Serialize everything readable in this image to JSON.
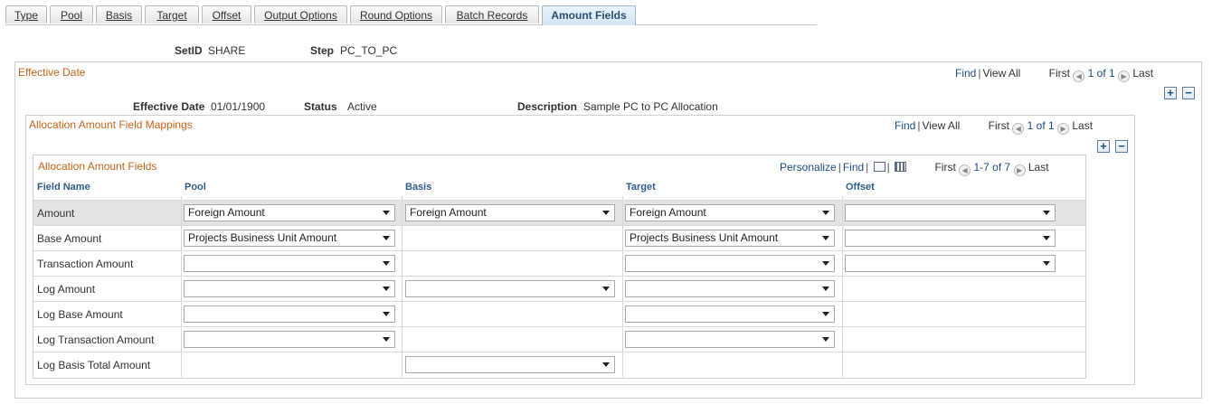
{
  "tabs": [
    {
      "label": "Type"
    },
    {
      "label": "Pool"
    },
    {
      "label": "Basis"
    },
    {
      "label": "Target"
    },
    {
      "label": "Offset"
    },
    {
      "label": "Output Options"
    },
    {
      "label": "Round Options"
    },
    {
      "label": "Batch Records"
    },
    {
      "label": "Amount Fields"
    }
  ],
  "header": {
    "setid_label": "SetID",
    "setid_value": "SHARE",
    "step_label": "Step",
    "step_value": "PC_TO_PC"
  },
  "effective_date_section": {
    "title": "Effective Date",
    "nav": {
      "find": "Find",
      "view_all": "View All",
      "first": "First",
      "count": "1 of 1",
      "last": "Last"
    },
    "effective_date_label": "Effective Date",
    "effective_date_value": "01/01/1900",
    "status_label": "Status",
    "status_value": "Active",
    "description_label": "Description",
    "description_value": "Sample PC to PC Allocation"
  },
  "mappings_section": {
    "title": "Allocation Amount Field Mappings",
    "nav": {
      "find": "Find",
      "view_all": "View All",
      "first": "First",
      "count": "1 of 1",
      "last": "Last"
    }
  },
  "grid": {
    "title": "Allocation Amount Fields",
    "nav": {
      "personalize": "Personalize",
      "find": "Find",
      "first": "First",
      "count": "1-7 of 7",
      "last": "Last"
    },
    "columns": [
      "Field Name",
      "Pool",
      "Basis",
      "Target",
      "Offset"
    ],
    "rows": [
      {
        "field": "Amount",
        "pool": "Foreign Amount",
        "basis": "Foreign Amount",
        "target": "Foreign Amount",
        "offset": ""
      },
      {
        "field": "Base Amount",
        "pool": "Projects Business Unit Amount",
        "target": "Projects Business Unit Amount",
        "offset": ""
      },
      {
        "field": "Transaction Amount",
        "pool": "",
        "target": "",
        "offset": ""
      },
      {
        "field": "Log Amount",
        "pool": "",
        "basis": "",
        "target": ""
      },
      {
        "field": "Log Base Amount",
        "pool": "",
        "target": ""
      },
      {
        "field": "Log Transaction Amount",
        "pool": "",
        "target": ""
      },
      {
        "field": "Log Basis Total Amount",
        "basis": ""
      }
    ]
  }
}
